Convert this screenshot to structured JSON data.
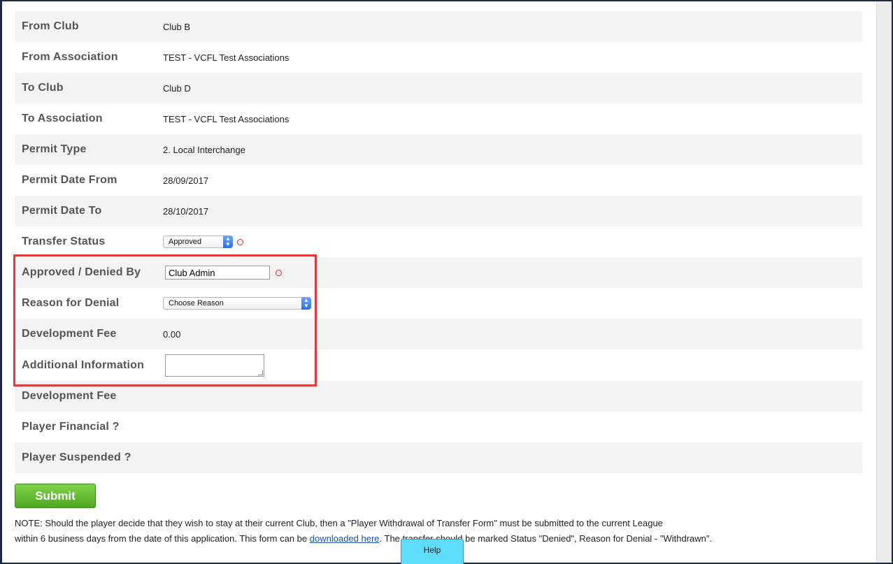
{
  "rows": [
    {
      "label": "From Club",
      "value": "Club B"
    },
    {
      "label": "From Association",
      "value": "TEST - VCFL Test Associations"
    },
    {
      "label": "To Club",
      "value": "Club D"
    },
    {
      "label": "To Association",
      "value": "TEST - VCFL Test Associations"
    },
    {
      "label": "Permit Type",
      "value": "2. Local Interchange"
    },
    {
      "label": "Permit Date From",
      "value": "28/09/2017"
    },
    {
      "label": "Permit Date To",
      "value": "28/10/2017"
    },
    {
      "label": "Transfer Status",
      "select_value": "Approved"
    },
    {
      "label": "Approved / Denied By",
      "input_value": "Club Admin"
    },
    {
      "label": "Reason for Denial",
      "select_value": "Choose Reason"
    },
    {
      "label": "Development Fee",
      "value": "0.00"
    },
    {
      "label": "Additional Information",
      "textarea_value": ""
    },
    {
      "label": "Development Fee"
    },
    {
      "label": "Player Financial ?"
    },
    {
      "label": "Player Suspended ?"
    }
  ],
  "submit_label": "Submit",
  "note": {
    "line1": "NOTE: Should the player decide that they wish to stay at their current Club, then a \"Player Withdrawal of Transfer Form\" must be submitted to the current League",
    "line2_before": "within 6 business days from the date of this application. This form can be ",
    "link": "downloaded here",
    "line2_after": ". The transfer should be marked Status \"Denied\", Reason for Denial - \"Withdrawn\"."
  },
  "help_label": "Help",
  "colors": {
    "highlight_border": "#e03a3a",
    "submit_green": "#5cb82c",
    "help_cyan": "#5fdcfa"
  }
}
